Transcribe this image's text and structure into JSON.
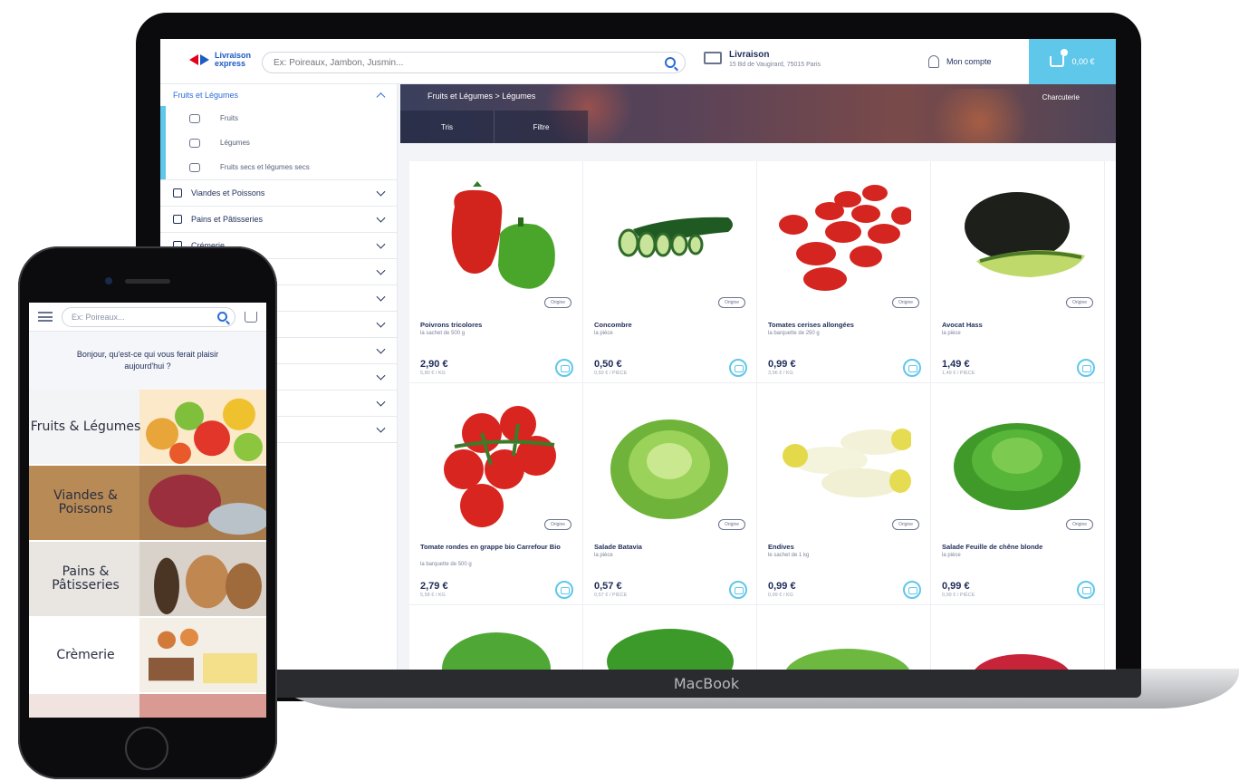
{
  "laptop": {
    "brand": "MacBook",
    "header": {
      "logo_line1": "Livraison",
      "logo_line2": "express",
      "search_placeholder": "Ex: Poireaux, Jambon, Jusmin...",
      "delivery_title": "Livraison",
      "delivery_address": "15 Bd de Vaugirard, 75015 Paris",
      "account_label": "Mon compte",
      "cart_label": "0,00 €"
    },
    "sidebar": {
      "open_category": "Fruits et Légumes",
      "subcategories": [
        "Fruits",
        "Légumes",
        "Fruits secs et légumes secs"
      ],
      "categories": [
        "Viandes et Poissons",
        "Pains et Pâtisseries",
        "Crémerie"
      ]
    },
    "banner": {
      "title": "Fruits et Légumes > Légumes",
      "right_label": "Charcuterie",
      "tabs": [
        "Tris",
        "Filtre"
      ]
    },
    "products": [
      {
        "name": "Poivrons tricolores",
        "sub": "la sachet de 500 g",
        "price": "2,90 €",
        "unit": "5,80 € / KG",
        "badge": "Origine"
      },
      {
        "name": "Concombre",
        "sub": "la pièce",
        "price": "0,50 €",
        "unit": "0,50 € / PIÈCE",
        "badge": "Origine"
      },
      {
        "name": "Tomates cerises allongées",
        "sub": "la barquette de 250 g",
        "price": "0,99 €",
        "unit": "3,96 € / KG",
        "badge": "Origine"
      },
      {
        "name": "Avocat Hass",
        "sub": "la pièce",
        "price": "1,49 €",
        "unit": "1,49 € / PIÈCE",
        "badge": "Origine"
      },
      {
        "name": "Tomate rondes en grappe bio Carrefour Bio",
        "sub": "la barquette de 500 g",
        "price": "2,79 €",
        "unit": "5,58 € / KG",
        "badge": "Origine"
      },
      {
        "name": "Salade Batavia",
        "sub": "la pièce",
        "price": "0,57 €",
        "unit": "0,57 € / PIÈCE",
        "badge": "Origine"
      },
      {
        "name": "Endives",
        "sub": "le sachet de 1 kg",
        "price": "0,99 €",
        "unit": "0,99 € / KG",
        "badge": "Origine"
      },
      {
        "name": "Salade Feuille de chêne blonde",
        "sub": "la pièce",
        "price": "0,99 €",
        "unit": "0,99 € / PIÈCE",
        "badge": "Origine"
      }
    ]
  },
  "phone": {
    "search_placeholder": "Ex: Poireaux...",
    "greeting": "Bonjour, qu'est-ce qui vous ferait plaisir aujourd'hui ?",
    "categories": [
      {
        "label": "Fruits & Légumes"
      },
      {
        "label": "Viandes & Poissons"
      },
      {
        "label": "Pains & Pâtisseries"
      },
      {
        "label": "Crèmerie"
      }
    ]
  }
}
